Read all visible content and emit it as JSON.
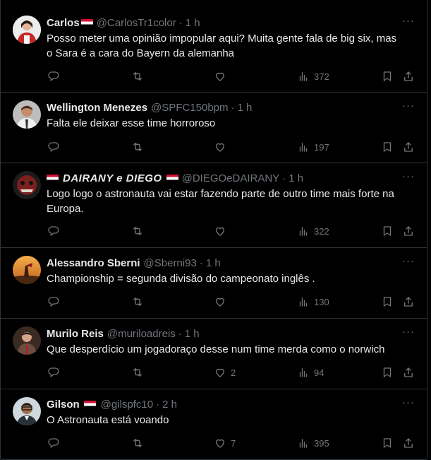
{
  "tweets": [
    {
      "name": "Carlos",
      "flag_after_name": true,
      "handle": "@CarlosTr1color",
      "time": "1 h",
      "text_lines": [
        "Posso meter uma opinião impopular aqui? Muita gente fala de big six, mas",
        "o Sara é a cara do Bayern da alemanha"
      ],
      "likes": "",
      "views": "372",
      "avatar_colors": [
        "#c62828",
        "#f5f5f5"
      ]
    },
    {
      "name": "Wellington Menezes",
      "flag_after_name": false,
      "handle": "@SPFC150bpm",
      "time": "1 h",
      "text_lines": [
        "Falta ele deixar esse time horroroso"
      ],
      "likes": "",
      "views": "197",
      "avatar_colors": [
        "#9e9e9e",
        "#5d4037"
      ]
    },
    {
      "name": "DAIRANY e DIEGO",
      "flag_after_name": true,
      "handle": "@DIEGOeDAIRANY",
      "time": "1 h",
      "text_lines": [
        "Logo logo o astronauta vai estar fazendo parte de outro time mais forte na",
        "Europa."
      ],
      "likes": "",
      "views": "322",
      "avatar_colors": [
        "#7b1f1f",
        "#1b1b1b"
      ]
    },
    {
      "name": "Alessandro Sberni",
      "flag_after_name": false,
      "handle": "@Sberni93",
      "time": "1 h",
      "text_lines": [
        "Championship = segunda divisão do campeonato inglês ."
      ],
      "likes": "",
      "views": "130",
      "avatar_colors": [
        "#e08a2c",
        "#5a2d10"
      ]
    },
    {
      "name": "Murilo Reis",
      "flag_after_name": false,
      "handle": "@muriloadreis",
      "time": "1 h",
      "text_lines": [
        "Que desperdício um jogadoraço desse num time merda como o norwich"
      ],
      "likes": "2",
      "views": "94",
      "avatar_colors": [
        "#6d4c41",
        "#2b2b2b"
      ]
    },
    {
      "name": "Gilson",
      "flag_after_name": true,
      "handle": "@gilspfc10",
      "time": "2 h",
      "text_lines": [
        "O Astronauta está voando"
      ],
      "likes": "7",
      "views": "395",
      "avatar_colors": [
        "#cfd8dc",
        "#263238"
      ]
    }
  ],
  "colors": {
    "background": "#000000",
    "text": "#e7e9ea",
    "secondary": "#71767b",
    "divider": "#2f3336"
  },
  "icons": {
    "reply": "reply-icon",
    "retweet": "retweet-icon",
    "like": "heart-icon",
    "views": "views-icon",
    "bookmark": "bookmark-icon",
    "share": "share-icon",
    "more": "more-icon"
  },
  "more_label": "···",
  "separator": "·"
}
